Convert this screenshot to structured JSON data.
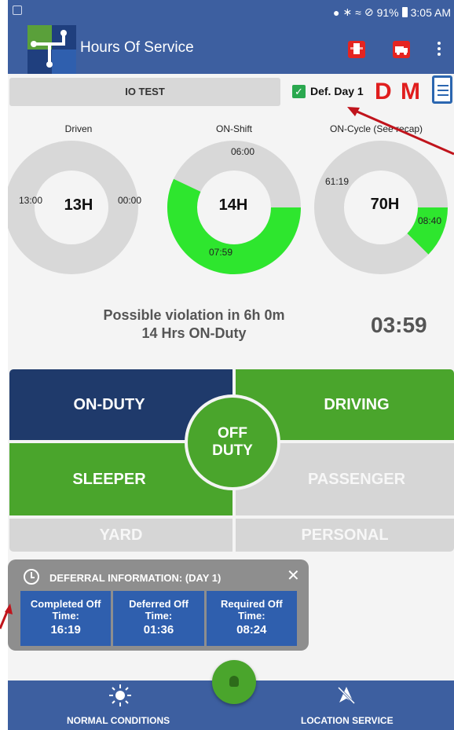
{
  "status_bar": {
    "battery": "91%",
    "time": "3:05 AM"
  },
  "app": {
    "title": "Hours Of Service"
  },
  "top_row": {
    "vehicle": "IO TEST",
    "deferral_checkbox_label": "Def. Day 1",
    "d_label": "D",
    "m_label": "M"
  },
  "gauges": [
    {
      "label": "Driven",
      "center": "13H",
      "left_value": "13:00",
      "right_value": "00:00",
      "fill_fraction": 0,
      "color": "#2ee62e"
    },
    {
      "label": "ON-Shift",
      "center": "14H",
      "top_value": "06:00",
      "bottom_value": "07:59",
      "fill_fraction": 0.57,
      "color": "#2ee62e"
    },
    {
      "label": "ON-Cycle (See recap)",
      "center": "70H",
      "left_value": "61:19",
      "right_value": "08:40",
      "fill_fraction": 0.124,
      "color": "#2ee62e"
    }
  ],
  "violation": {
    "line1": "Possible violation in 6h 0m",
    "line2": "14 Hrs ON-Duty",
    "countdown": "03:59"
  },
  "duty_status": {
    "on_duty": "ON-DUTY",
    "driving": "DRIVING",
    "sleeper": "SLEEPER",
    "passenger": "PASSENGER",
    "yard": "YARD",
    "personal": "PERSONAL",
    "off_duty_line1": "OFF",
    "off_duty_line2": "DUTY"
  },
  "deferral": {
    "title": "DEFERRAL INFORMATION: (DAY 1)",
    "tiles": [
      {
        "label1": "Completed Off",
        "label2": "Time:",
        "value": "16:19"
      },
      {
        "label1": "Deferred Off",
        "label2": "Time:",
        "value": "01:36"
      },
      {
        "label1": "Required Off",
        "label2": "Time:",
        "value": "08:24"
      }
    ]
  },
  "bottom_bar": {
    "left_label": "NORMAL CONDITIONS",
    "right_label": "LOCATION SERVICE"
  },
  "colors": {
    "primary": "#3d5fa0",
    "green": "#4aa52c",
    "navy": "#1f3a6b",
    "gauge_gray": "#d8d8d8",
    "red": "#e01e1e"
  }
}
